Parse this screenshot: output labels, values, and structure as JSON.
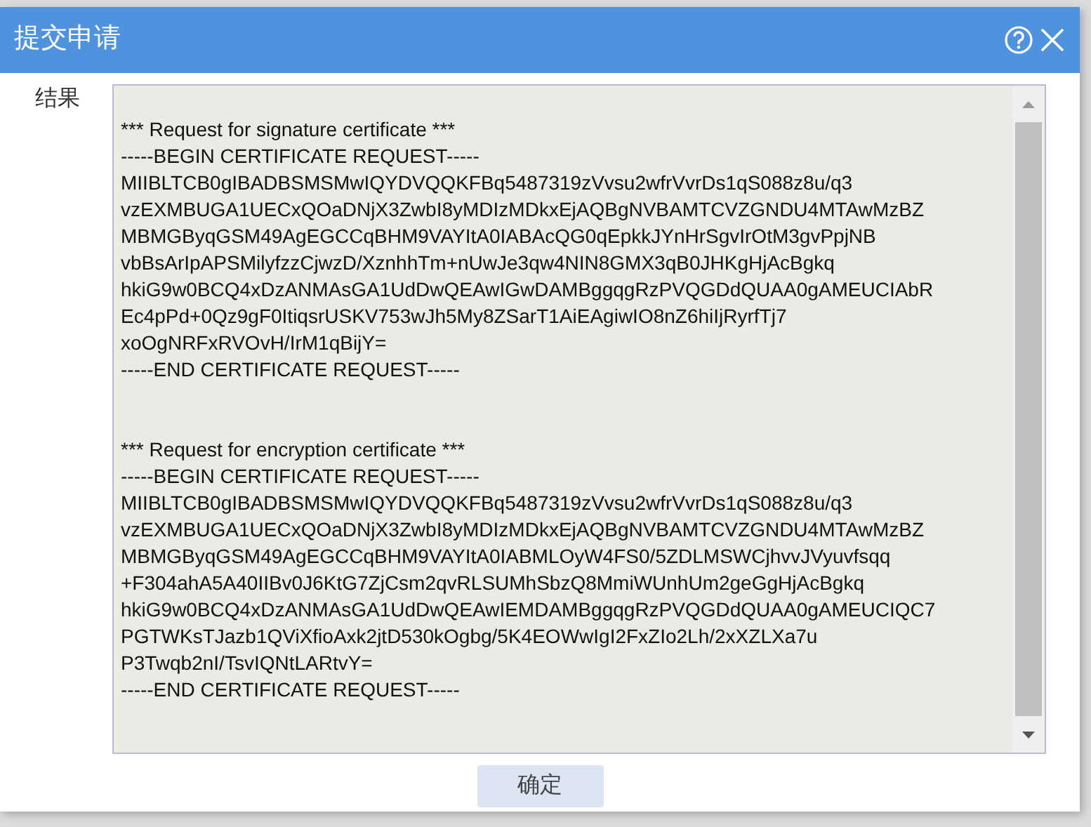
{
  "window": {
    "title": "提交申请"
  },
  "field": {
    "label": "结果",
    "sections": [
      [
        "*** Request for signature certificate ***",
        "-----BEGIN CERTIFICATE REQUEST-----",
        "MIIBLTCB0gIBADBSMSMwIQYDVQQKFBq5487319zVvsu2wfrVvrDs1qS088z8u/q3",
        "vzEXMBUGA1UECxQOaDNjX3ZwbI8yMDIzMDkxEjAQBgNVBAMTCVZGNDU4MTAwMzBZ",
        "MBMGByqGSM49AgEGCCqBHM9VAYItA0IABAcQG0qEpkkJYnHrSgvIrOtM3gvPpjNB",
        "vbBsArIpAPSMilyfzzCjwzD/XznhhTm+nUwJe3qw4NIN8GMX3qB0JHKgHjAcBgkq",
        "hkiG9w0BCQ4xDzANMAsGA1UdDwQEAwIGwDAMBggqgRzPVQGDdQUAA0gAMEUCIAbR",
        "Ec4pPd+0Qz9gF0ItiqsrUSKV753wJh5My8ZSarT1AiEAgiwIO8nZ6hiIjRyrfTj7",
        "xoOgNRFxRVOvH/IrM1qBijY=",
        "-----END CERTIFICATE REQUEST-----"
      ],
      [
        "*** Request for encryption certificate ***",
        "-----BEGIN CERTIFICATE REQUEST-----",
        "MIIBLTCB0gIBADBSMSMwIQYDVQQKFBq5487319zVvsu2wfrVvrDs1qS088z8u/q3",
        "vzEXMBUGA1UECxQOaDNjX3ZwbI8yMDIzMDkxEjAQBgNVBAMTCVZGNDU4MTAwMzBZ",
        "MBMGByqGSM49AgEGCCqBHM9VAYItA0IABMLOyW4FS0/5ZDLMSWCjhvvJVyuvfsqq",
        "+F304ahA5A40IIBv0J6KtG7ZjCsm2qvRLSUMhSbzQ8MmiWUnhUm2geGgHjAcBgkq",
        "hkiG9w0BCQ4xDzANMAsGA1UdDwQEAwIEMDAMBggqgRzPVQGDdQUAA0gAMEUCIQC7",
        "PGTWKsTJazb1QViXfioAxk2jtD530kOgbg/5K4EOWwIgI2FxZIo2Lh/2xXZLXa7u",
        "P3Twqb2nI/TsvIQNtLARtvY=",
        "-----END CERTIFICATE REQUEST-----"
      ]
    ]
  },
  "buttons": [
    "确定"
  ]
}
